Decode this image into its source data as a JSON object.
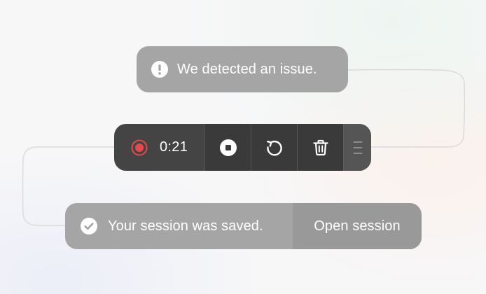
{
  "notice": {
    "message": "We detected an issue.",
    "icon": "exclamation-circle-icon"
  },
  "recorder": {
    "time": "0:21",
    "status_icon": "record-dot-icon",
    "status_color": "#e5484d",
    "buttons": [
      {
        "icon": "stop-icon"
      },
      {
        "icon": "restart-icon"
      },
      {
        "icon": "trash-icon"
      }
    ],
    "handle_icon": "drag-handle-icon"
  },
  "toast": {
    "message": "Your session was saved.",
    "icon": "check-circle-icon",
    "action_label": "Open session"
  },
  "colors": {
    "pill_light": "#a5a5a5",
    "toolbar_dark": "#444444",
    "button_dark": "#3a3a3a"
  }
}
